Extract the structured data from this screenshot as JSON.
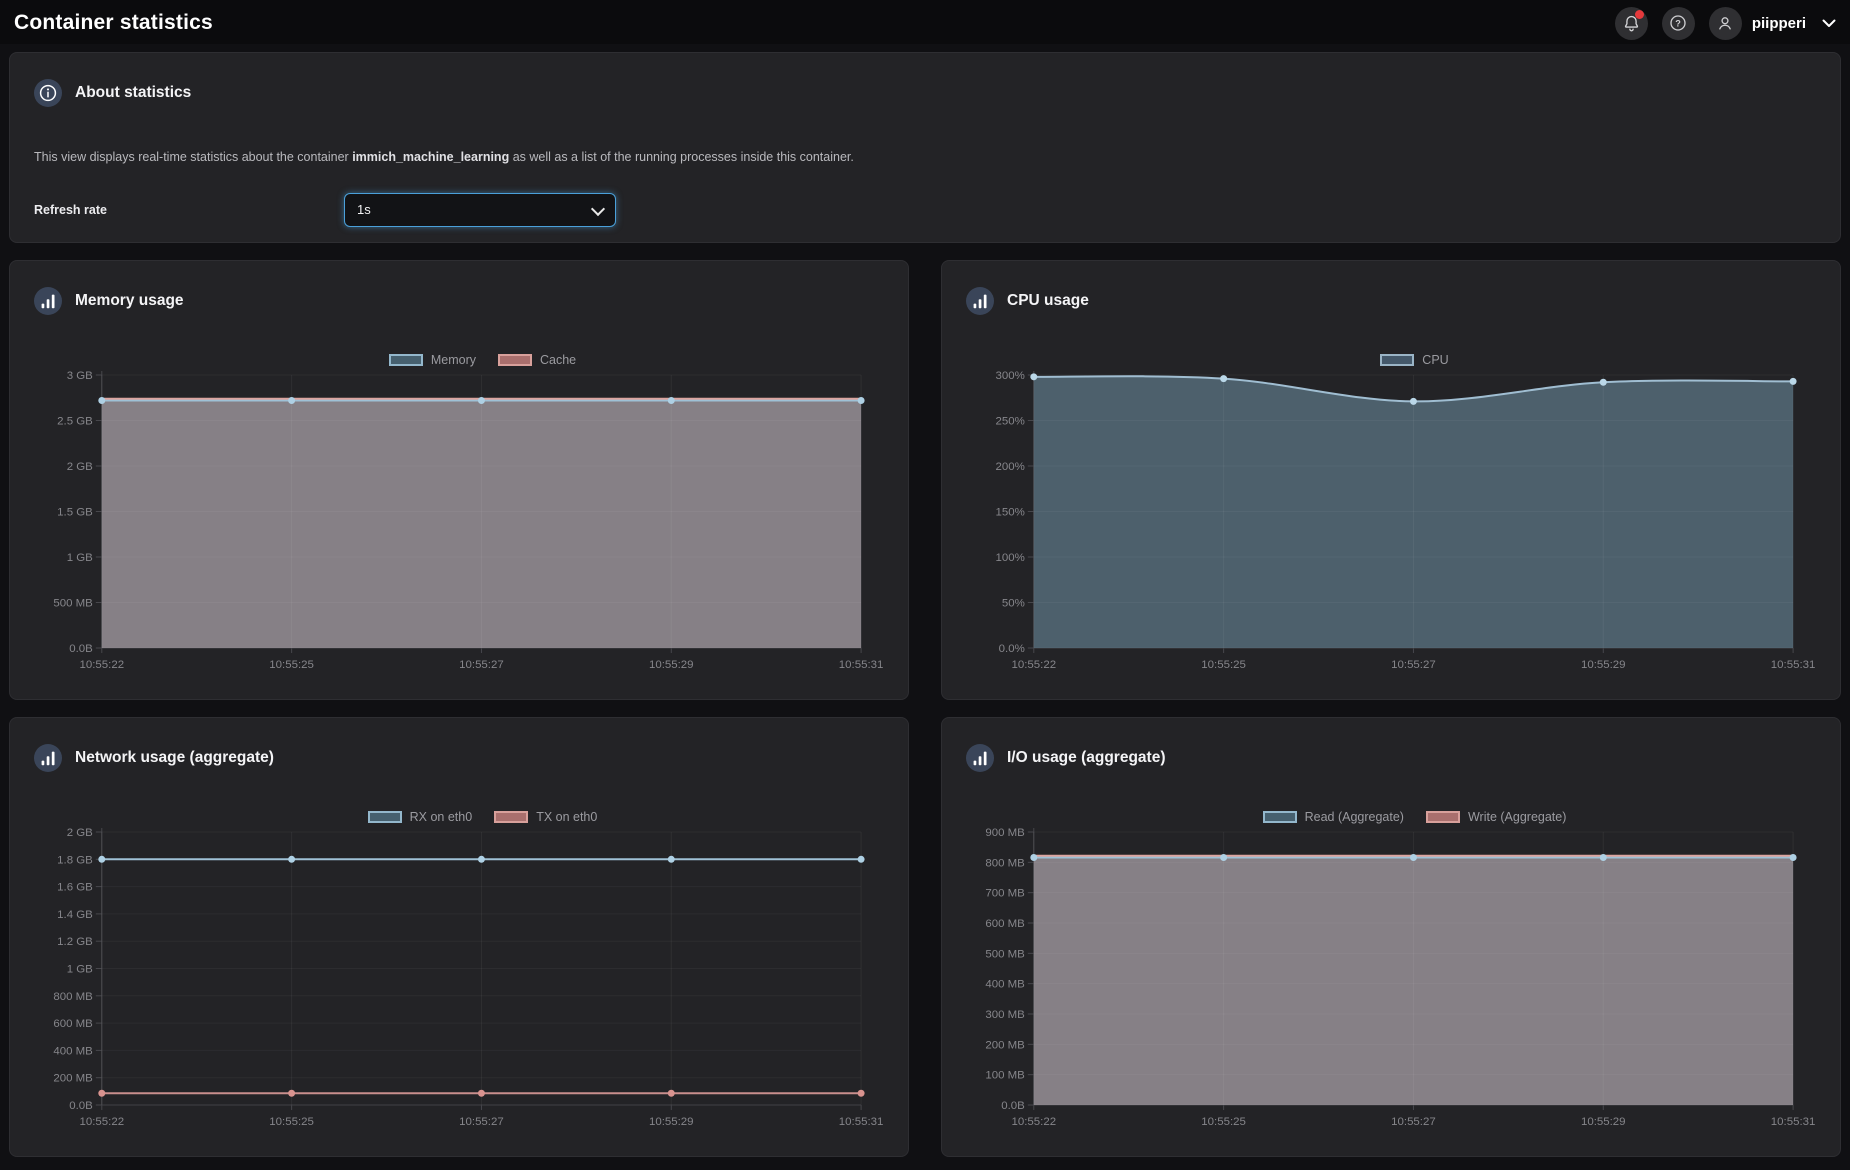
{
  "header": {
    "title": "Container statistics",
    "username": "piipperi",
    "icons": {
      "notifications": "bell-with-red-dot",
      "help": "question-mark-circle",
      "user": "person-circle",
      "menu": "chevron-down"
    }
  },
  "about": {
    "title": "About statistics",
    "icon": "info-circle",
    "description_prefix": "This view displays real-time statistics about the container ",
    "container_name": "immich_machine_learning",
    "description_suffix": " as well as a list of the running processes inside this container.",
    "refresh_label": "Refresh rate",
    "refresh_value": "1s"
  },
  "colors": {
    "page_bg": "#101013",
    "header_bg": "#0b0b0d",
    "panel_bg": "#232326",
    "accent_blue": "#4aa0da",
    "notification_red": "#e5393c",
    "icon_circle": "#3a4559",
    "series_blue_line": "#a0bed2",
    "series_blue_fill": "#4d606c",
    "series_pink_line": "#dca5a0",
    "overlap_fill": "#868086",
    "axis_text": "#86868b"
  },
  "charts": [
    {
      "id": "memory",
      "title": "Memory usage",
      "icon": "bar-chart",
      "legend": [
        {
          "label": "Memory",
          "fill": "#46606f",
          "border": "#93b7cc"
        },
        {
          "label": "Cache",
          "fill": "#a96f6d",
          "border": "#d8a09b"
        }
      ],
      "chart_data": {
        "type": "area",
        "x": [
          "10:55:22",
          "10:55:25",
          "10:55:27",
          "10:55:29",
          "10:55:31"
        ],
        "y_ticks": [
          "3 GB",
          "2.5 GB",
          "2 GB",
          "1.5 GB",
          "1 GB",
          "500 MB",
          "0.0B"
        ],
        "ylim": [
          0,
          3
        ],
        "unit": "GB",
        "smooth": false,
        "series": [
          {
            "name": "Memory",
            "values": [
              2.72,
              2.72,
              2.72,
              2.72,
              2.72
            ],
            "line_color": "#9ec1d6",
            "dot_color": "#aed0e4",
            "area_color": "#868086"
          },
          {
            "name": "Cache",
            "values": [
              2.74,
              2.74,
              2.74,
              2.74,
              2.74
            ],
            "line_color": "#dca5a0",
            "dot_color": null,
            "area_color": null
          }
        ]
      }
    },
    {
      "id": "cpu",
      "title": "CPU usage",
      "icon": "bar-chart",
      "legend": [
        {
          "label": "CPU",
          "fill": "#44586a",
          "border": "#9ab4c6"
        }
      ],
      "chart_data": {
        "type": "area",
        "x": [
          "10:55:22",
          "10:55:25",
          "10:55:27",
          "10:55:29",
          "10:55:31"
        ],
        "y_ticks": [
          "300%",
          "250%",
          "200%",
          "150%",
          "100%",
          "50%",
          "0.0%"
        ],
        "ylim": [
          0,
          300
        ],
        "unit": "%",
        "smooth": true,
        "series": [
          {
            "name": "CPU",
            "values": [
              298,
              296,
              271,
              292,
              293
            ],
            "line_color": "#a0bed2",
            "dot_color": "#bad7e8",
            "area_color": "#4d606c"
          }
        ]
      }
    },
    {
      "id": "network",
      "title": "Network usage (aggregate)",
      "icon": "bar-chart",
      "legend": [
        {
          "label": "RX on eth0",
          "fill": "#46606f",
          "border": "#93b7cc"
        },
        {
          "label": "TX on eth0",
          "fill": "#a96f6d",
          "border": "#d8a09b"
        }
      ],
      "chart_data": {
        "type": "line",
        "x": [
          "10:55:22",
          "10:55:25",
          "10:55:27",
          "10:55:29",
          "10:55:31"
        ],
        "y_ticks": [
          "2 GB",
          "1.8 GB",
          "1.6 GB",
          "1.4 GB",
          "1.2 GB",
          "1 GB",
          "800 MB",
          "600 MB",
          "400 MB",
          "200 MB",
          "0.0B"
        ],
        "ylim": [
          0,
          2
        ],
        "unit": "GB",
        "smooth": false,
        "series": [
          {
            "name": "RX on eth0",
            "values": [
              1.8,
              1.8,
              1.8,
              1.8,
              1.8
            ],
            "line_color": "#9ec1d6",
            "dot_color": "#aed0e4",
            "area_color": null
          },
          {
            "name": "TX on eth0",
            "values": [
              0.086,
              0.086,
              0.086,
              0.086,
              0.086
            ],
            "line_color": "#c98f8d",
            "dot_color": "#d9938f",
            "area_color": null
          }
        ]
      }
    },
    {
      "id": "io",
      "title": "I/O usage (aggregate)",
      "icon": "bar-chart",
      "legend": [
        {
          "label": "Read (Aggregate)",
          "fill": "#46606f",
          "border": "#93b7cc"
        },
        {
          "label": "Write (Aggregate)",
          "fill": "#a96f6d",
          "border": "#d8a09b"
        }
      ],
      "chart_data": {
        "type": "area",
        "x": [
          "10:55:22",
          "10:55:25",
          "10:55:27",
          "10:55:29",
          "10:55:31"
        ],
        "y_ticks": [
          "900 MB",
          "800 MB",
          "700 MB",
          "600 MB",
          "500 MB",
          "400 MB",
          "300 MB",
          "200 MB",
          "100 MB",
          "0.0B"
        ],
        "ylim": [
          0,
          900
        ],
        "unit": "MB",
        "smooth": false,
        "series": [
          {
            "name": "Read (Aggregate)",
            "values": [
              816,
              816,
              816,
              816,
              816
            ],
            "line_color": "#9ec1d6",
            "dot_color": "#aed0e4",
            "area_color": "#868086"
          },
          {
            "name": "Write (Aggregate)",
            "values": [
              822,
              822,
              822,
              822,
              822
            ],
            "line_color": "#dca5a0",
            "dot_color": null,
            "area_color": null
          }
        ]
      }
    }
  ]
}
